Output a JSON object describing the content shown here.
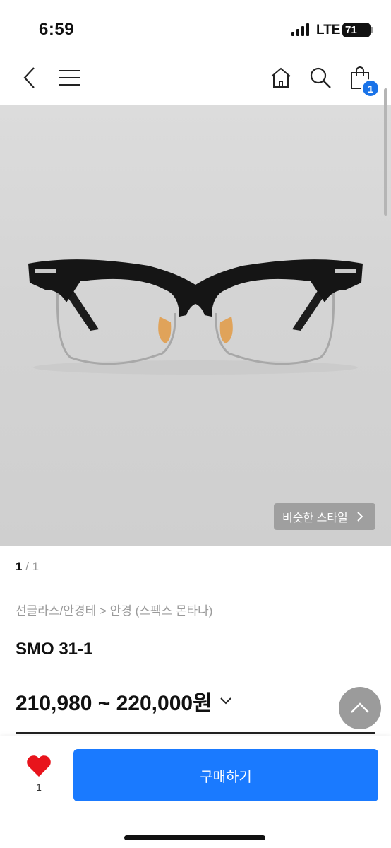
{
  "status_bar": {
    "time": "6:59",
    "network": "LTE",
    "battery": "71"
  },
  "nav": {
    "cart_count": "1"
  },
  "product": {
    "similar_label": "비슷한 스타일",
    "page_current": "1",
    "page_total": "1",
    "breadcrumb": "선글라스/안경테 > 안경 (스펙스 몬타나)",
    "name": "SMO 31-1",
    "price": "210,980 ~ 220,000원"
  },
  "bottom": {
    "like_count": "1",
    "buy_label": "구매하기"
  },
  "colors": {
    "accent": "#1a7aff",
    "badge": "#1a73e8",
    "heart": "#e8141c"
  },
  "icons": [
    "back-icon",
    "menu-icon",
    "home-icon",
    "search-icon",
    "shopping-bag-icon",
    "chevron-right-icon",
    "chevron-down-icon",
    "arrow-up-icon",
    "heart-icon"
  ]
}
